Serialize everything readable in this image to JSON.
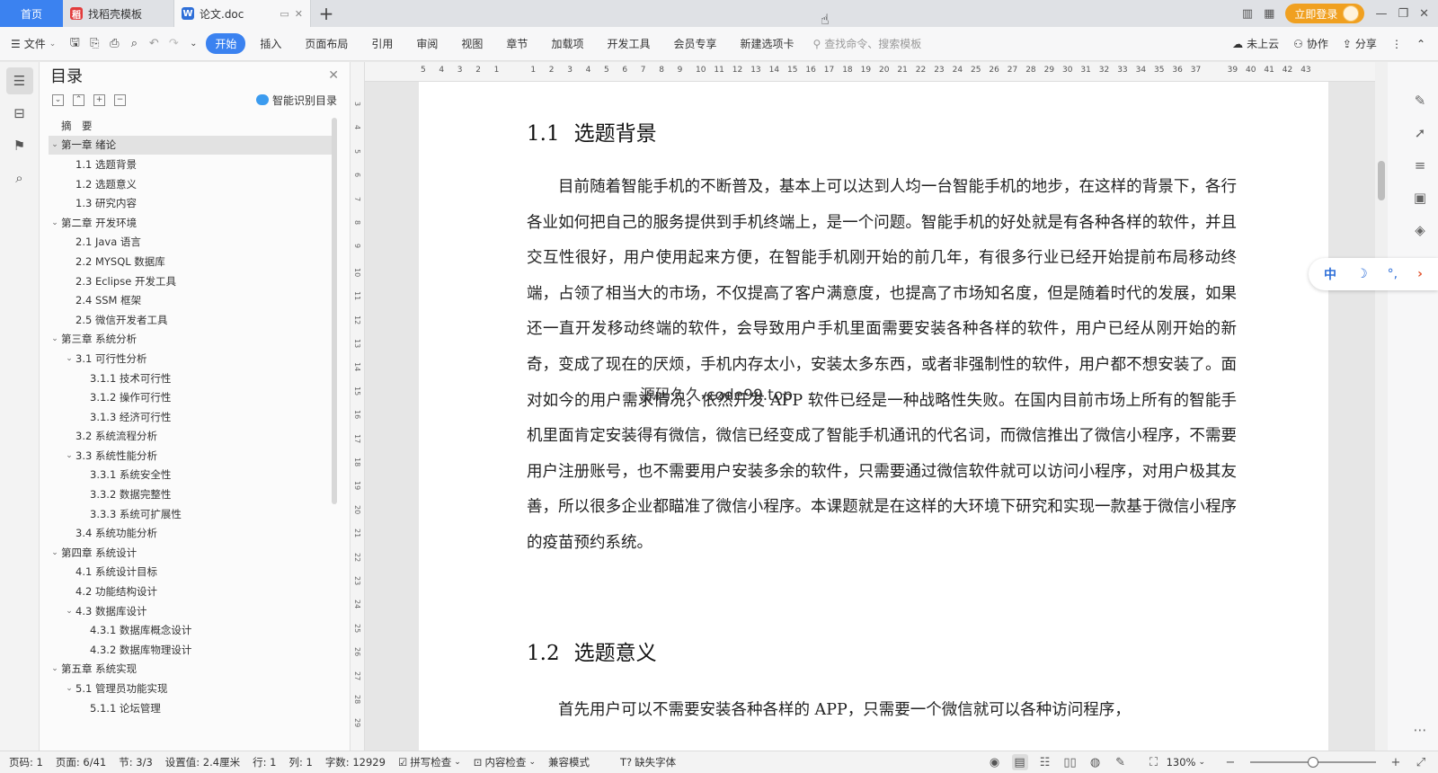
{
  "tabs": {
    "home": "首页",
    "items": [
      {
        "label": "找稻壳模板",
        "icon": "daoke-icon",
        "color": "#e23c3c",
        "glyph": "稻"
      },
      {
        "label": "论文.doc",
        "icon": "wps-writer-icon",
        "color": "#2f6fd8",
        "glyph": "W"
      }
    ],
    "new_tab": "+",
    "login": "立即登录"
  },
  "ribbon": {
    "file": "文件",
    "tabs": [
      "开始",
      "插入",
      "页面布局",
      "引用",
      "审阅",
      "视图",
      "章节",
      "加载项",
      "开发工具",
      "会员专享",
      "新建选项卡"
    ],
    "active_tab": "开始",
    "search_placeholder": "查找命令、搜索模板",
    "cloud": "未上云",
    "collab": "协作",
    "share": "分享"
  },
  "toc": {
    "title": "目录",
    "smart_label": "智能识别目录",
    "items": [
      {
        "text": "摘　要",
        "level": 0,
        "caret": ""
      },
      {
        "text": "第一章  绪论",
        "level": 0,
        "caret": "v",
        "selected": true
      },
      {
        "text": "1.1  选题背景",
        "level": 1,
        "caret": ""
      },
      {
        "text": "1.2  选题意义",
        "level": 1,
        "caret": ""
      },
      {
        "text": "1.3  研究内容",
        "level": 1,
        "caret": ""
      },
      {
        "text": "第二章  开发环境",
        "level": 0,
        "caret": "v"
      },
      {
        "text": "2.1 Java 语言",
        "level": 1,
        "caret": ""
      },
      {
        "text": "2.2 MYSQL 数据库",
        "level": 1,
        "caret": ""
      },
      {
        "text": "2.3 Eclipse 开发工具",
        "level": 1,
        "caret": ""
      },
      {
        "text": "2.4 SSM 框架",
        "level": 1,
        "caret": ""
      },
      {
        "text": "2.5 微信开发者工具",
        "level": 1,
        "caret": ""
      },
      {
        "text": "第三章  系统分析",
        "level": 0,
        "caret": "v"
      },
      {
        "text": "3.1 可行性分析",
        "level": 1,
        "caret": "v"
      },
      {
        "text": "3.1.1 技术可行性",
        "level": 2,
        "caret": ""
      },
      {
        "text": "3.1.2 操作可行性",
        "level": 2,
        "caret": ""
      },
      {
        "text": "3.1.3 经济可行性",
        "level": 2,
        "caret": ""
      },
      {
        "text": "3.2 系统流程分析",
        "level": 1,
        "caret": ""
      },
      {
        "text": "3.3 系统性能分析",
        "level": 1,
        "caret": "v"
      },
      {
        "text": "3.3.1 系统安全性",
        "level": 2,
        "caret": ""
      },
      {
        "text": "3.3.2 数据完整性",
        "level": 2,
        "caret": ""
      },
      {
        "text": "3.3.3 系统可扩展性",
        "level": 2,
        "caret": ""
      },
      {
        "text": "3.4 系统功能分析",
        "level": 1,
        "caret": ""
      },
      {
        "text": "第四章  系统设计",
        "level": 0,
        "caret": "v"
      },
      {
        "text": "4.1  系统设计目标",
        "level": 1,
        "caret": ""
      },
      {
        "text": "4.2 功能结构设计",
        "level": 1,
        "caret": ""
      },
      {
        "text": "4.3 数据库设计",
        "level": 1,
        "caret": "v"
      },
      {
        "text": "4.3.1  数据库概念设计",
        "level": 2,
        "caret": ""
      },
      {
        "text": "4.3.2  数据库物理设计",
        "level": 2,
        "caret": ""
      },
      {
        "text": "第五章  系统实现",
        "level": 0,
        "caret": "v"
      },
      {
        "text": "5.1 管理员功能实现",
        "level": 1,
        "caret": "v"
      },
      {
        "text": "5.1.1  论坛管理",
        "level": 2,
        "caret": ""
      }
    ]
  },
  "rulers": {
    "h": [
      "5",
      "4",
      "3",
      "2",
      "1",
      "",
      "1",
      "2",
      "3",
      "4",
      "5",
      "6",
      "7",
      "8",
      "9",
      "10",
      "11",
      "12",
      "13",
      "14",
      "15",
      "16",
      "17",
      "18",
      "19",
      "20",
      "21",
      "22",
      "23",
      "24",
      "25",
      "26",
      "27",
      "28",
      "29",
      "30",
      "31",
      "32",
      "33",
      "34",
      "35",
      "36",
      "37",
      "",
      "39",
      "40",
      "41",
      "42",
      "43"
    ],
    "v": [
      "3",
      "4",
      "5",
      "6",
      "7",
      "8",
      "9",
      "10",
      "11",
      "12",
      "13",
      "14",
      "15",
      "16",
      "17",
      "18",
      "19",
      "20",
      "21",
      "22",
      "23",
      "24",
      "25",
      "26",
      "27",
      "28",
      "29"
    ]
  },
  "document": {
    "h1_num": "1.1",
    "h1_text": "选题背景",
    "p1": "目前随着智能手机的不断普及，基本上可以达到人均一台智能手机的地步，在这样的背景下，各行各业如何把自己的服务提供到手机终端上，是一个问题。智能手机的好处就是有各种各样的软件，并且交互性很好，用户使用起来方便，在智能手机刚开始的前几年，有很多行业已经开始提前布局移动终端，占领了相当大的市场，不仅提高了客户满意度，也提高了市场知名度，但是随着时代的发展，如果还一直开发移动终端的软件，会导致用户手机里面需要安装各种各样的软件，用户已经从刚开始的新奇，变成了现在的厌烦，手机内存太小，安装太多东西，或者非强制性的软件，用户都不想安装了。面对如今的用户需求情况，依然开发 APP 软件已经是一种战略性失败。在国内目前市场上所有的智能手机里面肯定安装得有微信，微信已经变成了智能手机通讯的代名词，而微信推出了微信小程序，不需要用户注册账号，也不需要用户安装多余的软件，只需要通过微信软件就可以访问小程序，对用户极其友善，所以很多企业都瞄准了微信小程序。本课题就是在这样的大环境下研究和实现一款基于微信小程序的疫苗预约系统。",
    "watermark": "源码久久-code99.top",
    "h2_num": "1.2",
    "h2_text": "选题意义",
    "p2": "首先用户可以不需要安装各种各样的 APP，只需要一个微信就可以各种访问程序，"
  },
  "ime": {
    "lang": "中",
    "moon": "☽",
    "punct": "°,",
    "arrow": "›"
  },
  "status": {
    "page_num": "页码: 1",
    "page": "页面: 6/41",
    "section": "节: 3/3",
    "setting": "设置值: 2.4厘米",
    "row": "行: 1",
    "col": "列: 1",
    "words": "字数: 12929",
    "spell": "拼写检查",
    "content_check": "内容检查",
    "compat": "兼容模式",
    "missing_font": "缺失字体",
    "zoom": "130%",
    "zoom_level": 0.5
  }
}
